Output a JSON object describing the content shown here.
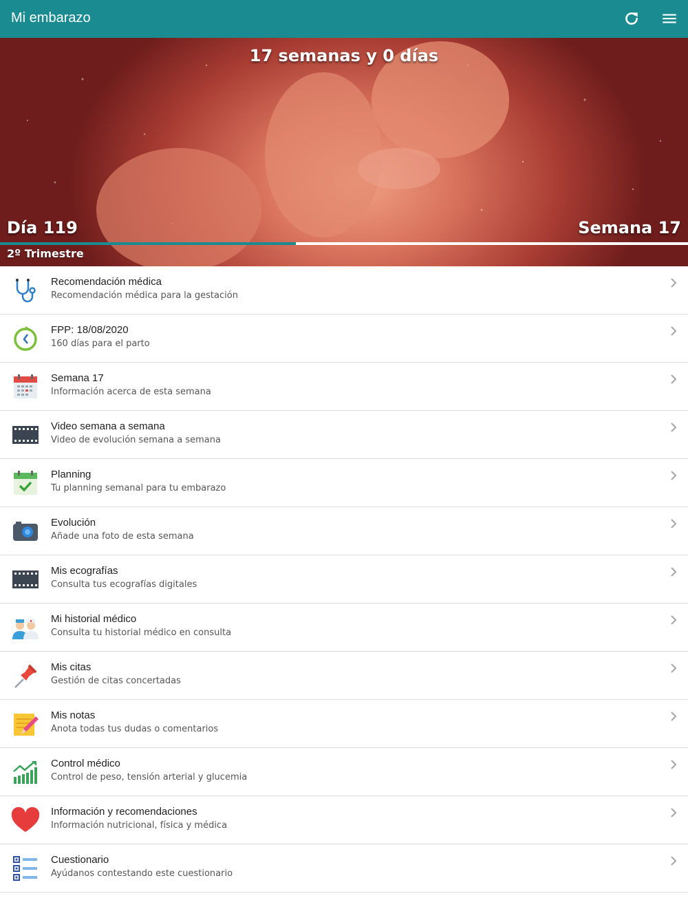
{
  "app": {
    "title": "Mi embarazo",
    "accent": "#1a8c91",
    "actions": [
      "refresh-icon",
      "menu-icon"
    ]
  },
  "hero": {
    "heading": "17 semanas y 0 días",
    "day_label": "Día 119",
    "week_label": "Semana 17",
    "trimester": "2º Trimestre",
    "progress_fraction": 0.43
  },
  "menu": [
    {
      "icon": "stethoscope-icon",
      "title": "Recomendación médica",
      "subtitle": "Recomendación médica para la gestación"
    },
    {
      "icon": "clock-icon",
      "title": "FPP: 18/08/2020",
      "subtitle": "160 días para el parto"
    },
    {
      "icon": "calendar-icon",
      "title": "Semana 17",
      "subtitle": "Información acerca de esta semana"
    },
    {
      "icon": "film-icon",
      "title": "Video semana a semana",
      "subtitle": "Video de evolución semana a semana"
    },
    {
      "icon": "calendar-check-icon",
      "title": "Planning",
      "subtitle": "Tu planning semanal para tu embarazo"
    },
    {
      "icon": "camera-icon",
      "title": "Evolución",
      "subtitle": "Añade una foto de esta semana"
    },
    {
      "icon": "film-icon",
      "title": "Mis ecografías",
      "subtitle": "Consulta tus ecografías digitales"
    },
    {
      "icon": "doctors-icon",
      "title": "Mi historial médico",
      "subtitle": "Consulta tu historial médico en consulta"
    },
    {
      "icon": "pushpin-icon",
      "title": "Mis citas",
      "subtitle": "Gestión de citas concertadas"
    },
    {
      "icon": "notepad-icon",
      "title": "Mis notas",
      "subtitle": "Anota todas tus dudas o comentarios"
    },
    {
      "icon": "growth-chart-icon",
      "title": "Control médico",
      "subtitle": "Control de peso, tensión arterial y glucemia"
    },
    {
      "icon": "heart-icon",
      "title": "Información y recomendaciones",
      "subtitle": "Información nutricional, física y médica"
    },
    {
      "icon": "checklist-icon",
      "title": "Cuestionario",
      "subtitle": "Ayúdanos contestando este cuestionario"
    }
  ]
}
